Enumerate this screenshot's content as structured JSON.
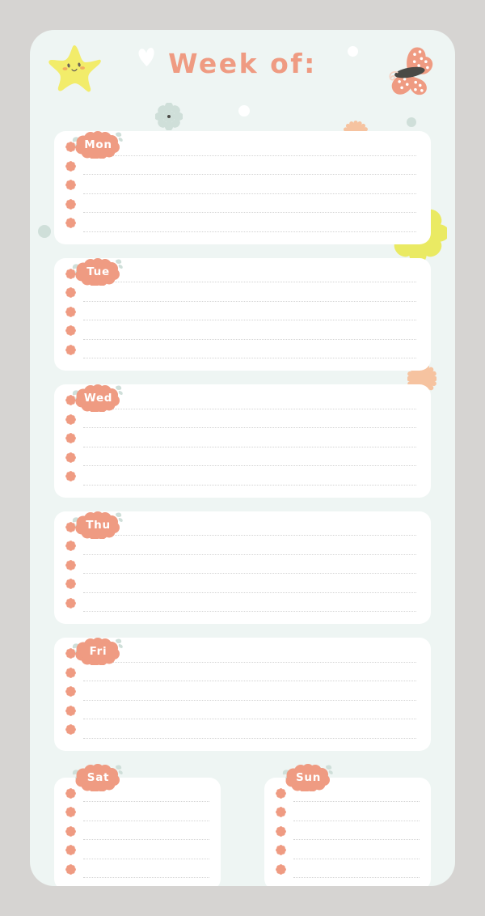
{
  "page": {
    "background_color": "#d6d4d2",
    "sheet_color": "#eef5f3",
    "accent_color": "#ef9b82",
    "card_color": "#ffffff",
    "line_color": "#d3d3d3"
  },
  "header": {
    "title": "Week of:",
    "decorations": [
      {
        "name": "star-smiley-icon",
        "color": "#f2ec6a"
      },
      {
        "name": "heart-icon",
        "color": "#ffffff"
      },
      {
        "name": "butterfly-icon",
        "color": "#ef9b82"
      },
      {
        "name": "flower-sage-icon",
        "color": "#cfdfd9"
      },
      {
        "name": "flower-peach-icon",
        "color": "#f6c3a0"
      },
      {
        "name": "dot-white-icon",
        "color": "#ffffff"
      },
      {
        "name": "dot-sage-icon",
        "color": "#cfdfd9"
      },
      {
        "name": "flower-yellow-icon",
        "color": "#eaea63"
      }
    ]
  },
  "days": [
    {
      "id": "mon",
      "label": "Mon",
      "rows": 5,
      "layout": "full"
    },
    {
      "id": "tue",
      "label": "Tue",
      "rows": 5,
      "layout": "full"
    },
    {
      "id": "wed",
      "label": "Wed",
      "rows": 5,
      "layout": "full"
    },
    {
      "id": "thu",
      "label": "Thu",
      "rows": 5,
      "layout": "full"
    },
    {
      "id": "fri",
      "label": "Fri",
      "rows": 5,
      "layout": "full"
    },
    {
      "id": "sat",
      "label": "Sat",
      "rows": 5,
      "layout": "half"
    },
    {
      "id": "sun",
      "label": "Sun",
      "rows": 5,
      "layout": "half"
    }
  ]
}
